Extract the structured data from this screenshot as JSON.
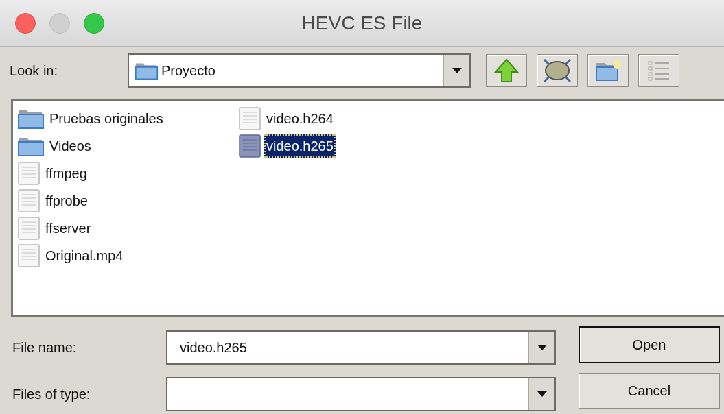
{
  "window": {
    "title": "HEVC ES File"
  },
  "look_in": {
    "label": "Look in:",
    "value": "Proyecto"
  },
  "files": [
    {
      "name": "Pruebas originales",
      "kind": "folder",
      "selected": false
    },
    {
      "name": "Videos",
      "kind": "folder",
      "selected": false
    },
    {
      "name": "ffmpeg",
      "kind": "file",
      "selected": false
    },
    {
      "name": "ffprobe",
      "kind": "file",
      "selected": false
    },
    {
      "name": "ffserver",
      "kind": "file",
      "selected": false
    },
    {
      "name": "Original.mp4",
      "kind": "file",
      "selected": false
    },
    {
      "name": "video.h264",
      "kind": "file",
      "selected": false
    },
    {
      "name": "video.h265",
      "kind": "file",
      "selected": true
    }
  ],
  "file_name": {
    "label": "File name:",
    "value": "video.h265"
  },
  "file_type": {
    "label": "Files of type:"
  },
  "buttons": [
    {
      "label": "Open",
      "default": true
    },
    {
      "label": "Cancel",
      "default": false
    }
  ]
}
